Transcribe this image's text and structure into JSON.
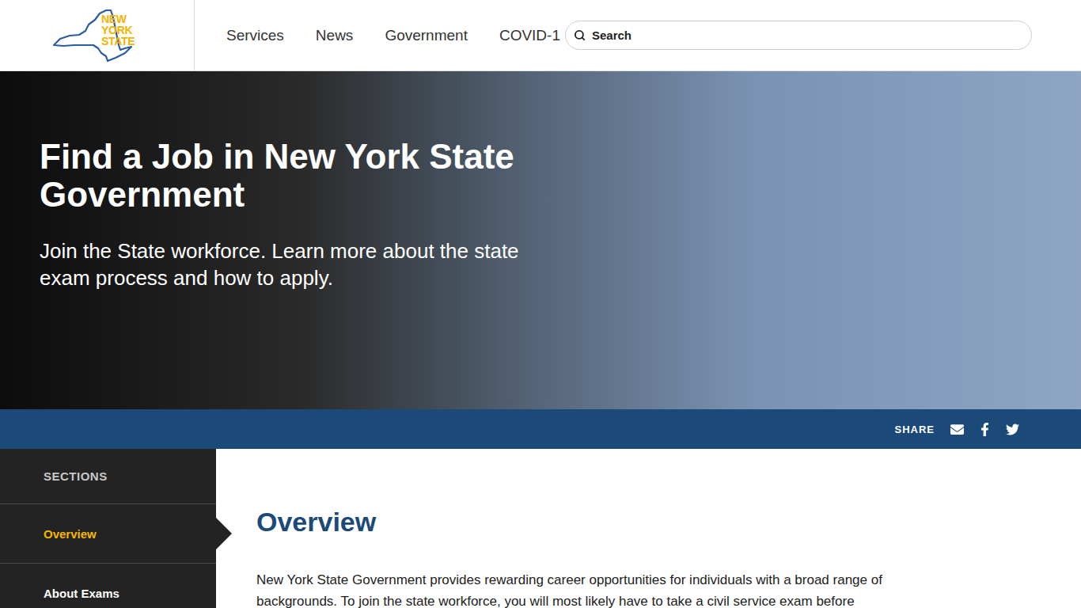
{
  "header": {
    "logo": [
      "NEW",
      "YORK",
      "STATE"
    ],
    "nav": [
      "Services",
      "News",
      "Government",
      "COVID-1"
    ],
    "search": {
      "placeholder": "Search"
    }
  },
  "hero": {
    "title": "Find a Job in New York State Government",
    "subtitle": "Join the State workforce. Learn more about the state exam process and how to apply."
  },
  "share": {
    "label": "SHARE"
  },
  "sidebar": {
    "heading": "SECTIONS",
    "items": [
      {
        "label": "Overview",
        "selected": true
      },
      {
        "label": "About Exams",
        "selected": false
      }
    ]
  },
  "content": {
    "heading": "Overview",
    "paragraph": "New York State Government provides rewarding career opportunities for individuals with a broad range of backgrounds. To join the state workforce, you will most likely have to take a civil service exam before"
  }
}
